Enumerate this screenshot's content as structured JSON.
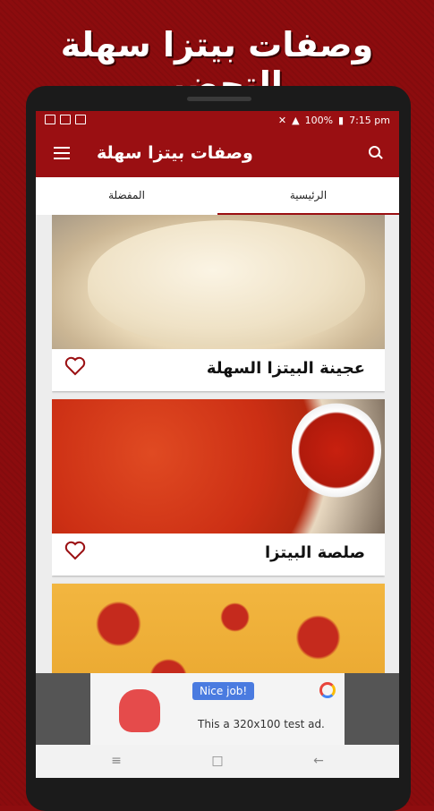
{
  "promo": {
    "title": "وصفات بيتزا سهلة التحضير"
  },
  "status_bar": {
    "battery": "100%",
    "time": "7:15 pm"
  },
  "app_bar": {
    "title": "وصفات بيتزا سهلة",
    "menu_icon": "menu-icon",
    "search_icon": "search-icon"
  },
  "tabs": [
    {
      "label": "المفضلة"
    },
    {
      "label": "الرئيسية"
    }
  ],
  "recipes": [
    {
      "title": "عجينة البيتزا السهلة"
    },
    {
      "title": "صلصة البيتزا"
    },
    {
      "title": ""
    }
  ],
  "ad": {
    "badge": "Nice job!",
    "text": "This a 320x100 test ad."
  },
  "colors": {
    "primary": "#9a0f12",
    "background": "#8c0c0e"
  }
}
